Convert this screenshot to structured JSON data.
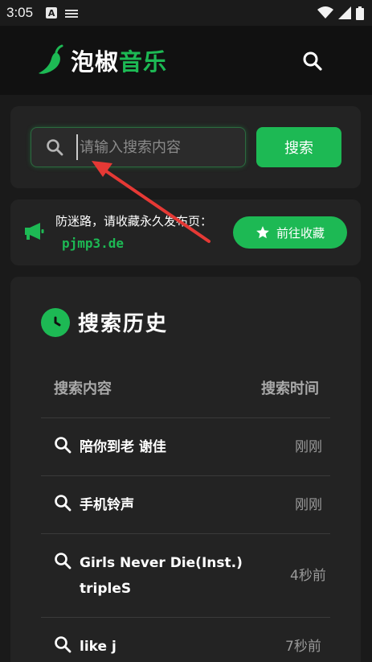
{
  "status_bar": {
    "time": "3:05",
    "a_label": "A"
  },
  "header": {
    "brand_part1": "泡椒",
    "brand_part2": "音乐"
  },
  "search": {
    "placeholder": "请输入搜索内容",
    "button_label": "搜索"
  },
  "notice": {
    "text": "防迷路，请收藏永久发布页：",
    "domain": "pjmp3.de",
    "button_label": "前往收藏"
  },
  "history": {
    "title": "搜索历史",
    "col_content": "搜索内容",
    "col_time": "搜索时间",
    "rows": [
      {
        "content": "陪你到老 谢佳",
        "time": "刚刚"
      },
      {
        "content": "手机铃声",
        "time": "刚刚"
      },
      {
        "content": "Girls Never Die(Inst.) tripleS",
        "time": "4秒前"
      },
      {
        "content": "like j",
        "time": "7秒前"
      }
    ]
  },
  "colors": {
    "accent": "#1db954",
    "background": "#1a1a1a",
    "card": "#232323",
    "annotation_arrow": "#e53935"
  }
}
